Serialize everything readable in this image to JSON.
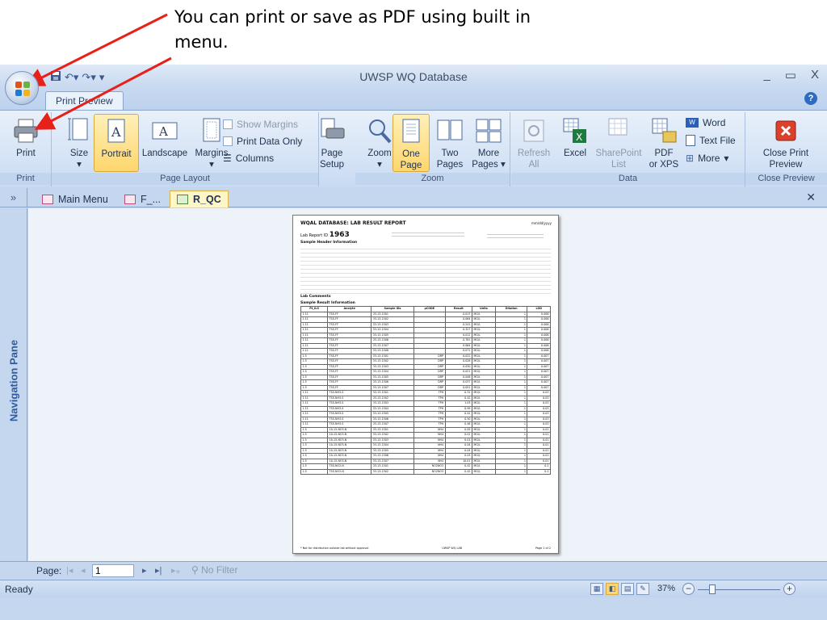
{
  "callout": {
    "line1": "You can print or save as PDF using built in",
    "line2": "menu."
  },
  "window": {
    "title": "UWSP WQ Database",
    "controls": [
      "_",
      "▭",
      "X"
    ]
  },
  "ribbon_tab": "Print Preview",
  "ribbon": {
    "print_group": {
      "label": "Print",
      "print": "Print"
    },
    "page_layout": {
      "label": "Page Layout",
      "size": "Size",
      "portrait": "Portrait",
      "landscape": "Landscape",
      "margins": "Margins",
      "show_margins": "Show Margins",
      "print_data_only": "Print Data Only",
      "columns": "Columns",
      "page_setup_1": "Page",
      "page_setup_2": "Setup"
    },
    "zoom": {
      "label": "Zoom",
      "zoom": "Zoom",
      "one_page_1": "One",
      "one_page_2": "Page",
      "two_pages_1": "Two",
      "two_pages_2": "Pages",
      "more_pages_1": "More",
      "more_pages_2": "Pages"
    },
    "data": {
      "label": "Data",
      "refresh_1": "Refresh",
      "refresh_2": "All",
      "excel": "Excel",
      "sharepoint_1": "SharePoint",
      "sharepoint_2": "List",
      "pdf_1": "PDF",
      "pdf_2": "or XPS",
      "word": "Word",
      "text_file": "Text File",
      "more": "More"
    },
    "close": {
      "label": "Close Preview",
      "btn_1": "Close Print",
      "btn_2": "Preview"
    }
  },
  "doc_tabs": [
    {
      "label": "Main Menu"
    },
    {
      "label": "F_..."
    },
    {
      "label": "R_QC"
    }
  ],
  "nav_toggle": "»",
  "nav_pane": "Navigation Pane",
  "report": {
    "title": "WQAL DATABASE: LAB RESULT REPORT",
    "date": "mm/dd/yyyy",
    "lab_report_label": "Lab Report ID",
    "lab_report_id": "1963",
    "sample_info": "Sample Header Information",
    "lab_comments": "Lab Comments",
    "sample_results": "Sample Result Information",
    "columns": [
      "Pt_ILG",
      "Analyte",
      "Sample IDs",
      "pCODE",
      "Result",
      "Units",
      "Dilution",
      "LOD"
    ],
    "rows": [
      [
        "1.11",
        "TSS-FF",
        "33-13-1501",
        "",
        "0.013",
        "MG/L",
        "1",
        "0.006"
      ],
      [
        "1.11",
        "TSS-FF",
        "33-13-1502",
        "",
        "0.064",
        "MG/L",
        "1",
        "0.006"
      ],
      [
        "1.11",
        "TSS-FF",
        "33-13-1503",
        "",
        "0.241",
        "MG/L",
        "1",
        "0.006"
      ],
      [
        "1.11",
        "TSS-FF",
        "33-13-1504",
        "",
        "0.327",
        "MG/L",
        "1",
        "0.006"
      ],
      [
        "1.11",
        "TSS-FF",
        "33-13-1505",
        "",
        "0.012",
        "MG/L",
        "1",
        "0.006"
      ],
      [
        "1.11",
        "TSS-FF",
        "33-13-1506",
        "",
        "0.781",
        "MG/L",
        "1",
        "0.006"
      ],
      [
        "1.11",
        "TSS-FF",
        "33-13-1507",
        "",
        "0.064",
        "MG/L",
        "1",
        "0.006"
      ],
      [
        "1.11",
        "TSS-FF",
        "33-13-1508",
        "",
        "0.071",
        "MG/L",
        "1",
        "0.006"
      ],
      [
        "1.5",
        "TSS-FF",
        "33-13-1501",
        "DRP",
        "0.022",
        "MG/L",
        "1",
        "0.007"
      ],
      [
        "1.5",
        "TSS-FF",
        "33-13-1502",
        "DRP",
        "0.028",
        "MG/L",
        "1",
        "0.007"
      ],
      [
        "1.5",
        "TSS-FF",
        "33-13-1503",
        "DRP",
        "0.030",
        "MG/L",
        "1",
        "0.007"
      ],
      [
        "1.5",
        "TSS-FF",
        "33-13-1504",
        "DRP",
        "0.021",
        "MG/L",
        "1",
        "0.007"
      ],
      [
        "1.5",
        "TSS-FF",
        "33-13-1505",
        "DRP",
        "0.046",
        "MG/L",
        "1",
        "0.007"
      ],
      [
        "1.5",
        "TSS-FF",
        "33-13-1506",
        "DRP",
        "0.037",
        "MG/L",
        "1",
        "0.007"
      ],
      [
        "1.5",
        "TSS-FF",
        "33-13-1507",
        "DRP",
        "0.051",
        "MG/L",
        "1",
        "0.007"
      ],
      [
        "1.11",
        "TSS-NH3-S",
        "33-13-1501",
        "TPH",
        "0.31",
        "MG/L",
        "1",
        "0.03"
      ],
      [
        "1.11",
        "TSS-NH3-S",
        "33-13-1502",
        "TPH",
        "0.42",
        "MG/L",
        "1",
        "0.03"
      ],
      [
        "1.11",
        "TSS-NH3-S",
        "33-13-1503",
        "TPH",
        "1.03",
        "MG/L",
        "1",
        "0.03"
      ],
      [
        "1.11",
        "TSS-NH3-S",
        "33-13-1504",
        "TPH",
        "0.99",
        "MG/L",
        "1",
        "0.03"
      ],
      [
        "1.11",
        "TSS-NH3-S",
        "33-13-1505",
        "TPH",
        "0.42",
        "MG/L",
        "1",
        "0.03"
      ],
      [
        "1.11",
        "TSS-NH3-S",
        "33-13-1506",
        "TPH",
        "0.50",
        "MG/L",
        "1",
        "0.03"
      ],
      [
        "1.11",
        "TSS-NH3-S",
        "33-13-1507",
        "TPH",
        "0.46",
        "MG/L",
        "1",
        "0.03"
      ],
      [
        "1.5",
        "10-15-NO3-N",
        "33-13-1501",
        "NH4",
        "0.05",
        "MG/L",
        "1",
        "0.01"
      ],
      [
        "1.5",
        "10-15-NO3-N",
        "33-13-1502",
        "NH4",
        "0.01",
        "MG/L",
        "1",
        "0.01"
      ],
      [
        "1.5",
        "10-15-NO3-N",
        "33-13-1503",
        "NH4",
        "0.01",
        "MG/L",
        "1",
        "0.01"
      ],
      [
        "1.5",
        "10-15-NO3-N",
        "33-13-1504",
        "NH4",
        "0.04",
        "MG/L",
        "1",
        "0.01"
      ],
      [
        "1.5",
        "10-15-NO3-N",
        "33-13-1505",
        "NH4",
        "0.04",
        "MG/L",
        "1",
        "0.01"
      ],
      [
        "1.5",
        "10-15-NO3-N",
        "33-13-1506",
        "NH4",
        "0.03",
        "MG/L",
        "1",
        "0.01"
      ],
      [
        "1.5",
        "10-15-NO3-N",
        "33-13-1507",
        "NH4",
        "10.01",
        "MG/L",
        "1",
        "0.01"
      ],
      [
        "1.5",
        "TSS-NO2-N",
        "33-13-1501",
        "NO2NO3",
        "0.42",
        "MG/L",
        "1",
        "0.1"
      ],
      [
        "1.5",
        "TSS-NO2-N",
        "33-13-1502",
        "NO2NO3",
        "0.42",
        "MG/L",
        "1",
        "0.1"
      ]
    ],
    "footer_left": "* Not for distribution outside lab without approval",
    "footer_mid": "UWSP WQ LAB",
    "footer_right": "Page 1 of 2"
  },
  "pager": {
    "label": "Page:",
    "value": "1",
    "first": "|◂",
    "prev": "◂",
    "next": "▸",
    "last": "▸|",
    "new": "▸⁎",
    "no_filter": "No Filter"
  },
  "status": {
    "ready": "Ready",
    "zoom": "37%",
    "minus": "−",
    "plus": "+"
  }
}
